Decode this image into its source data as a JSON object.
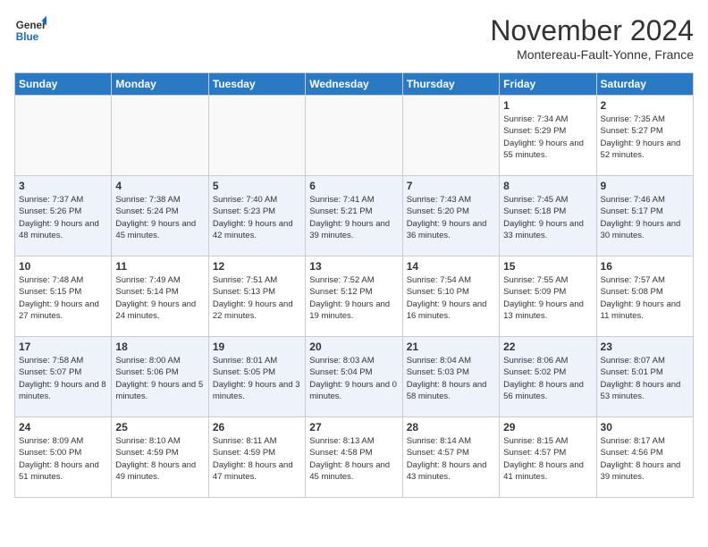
{
  "header": {
    "logo_general": "General",
    "logo_blue": "Blue",
    "month_title": "November 2024",
    "location": "Montereau-Fault-Yonne, France"
  },
  "weekdays": [
    "Sunday",
    "Monday",
    "Tuesday",
    "Wednesday",
    "Thursday",
    "Friday",
    "Saturday"
  ],
  "weeks": [
    [
      {
        "day": "",
        "empty": true
      },
      {
        "day": "",
        "empty": true
      },
      {
        "day": "",
        "empty": true
      },
      {
        "day": "",
        "empty": true
      },
      {
        "day": "",
        "empty": true
      },
      {
        "day": "1",
        "sunrise": "7:34 AM",
        "sunset": "5:29 PM",
        "daylight": "9 hours and 55 minutes."
      },
      {
        "day": "2",
        "sunrise": "7:35 AM",
        "sunset": "5:27 PM",
        "daylight": "9 hours and 52 minutes."
      }
    ],
    [
      {
        "day": "3",
        "sunrise": "7:37 AM",
        "sunset": "5:26 PM",
        "daylight": "9 hours and 48 minutes."
      },
      {
        "day": "4",
        "sunrise": "7:38 AM",
        "sunset": "5:24 PM",
        "daylight": "9 hours and 45 minutes."
      },
      {
        "day": "5",
        "sunrise": "7:40 AM",
        "sunset": "5:23 PM",
        "daylight": "9 hours and 42 minutes."
      },
      {
        "day": "6",
        "sunrise": "7:41 AM",
        "sunset": "5:21 PM",
        "daylight": "9 hours and 39 minutes."
      },
      {
        "day": "7",
        "sunrise": "7:43 AM",
        "sunset": "5:20 PM",
        "daylight": "9 hours and 36 minutes."
      },
      {
        "day": "8",
        "sunrise": "7:45 AM",
        "sunset": "5:18 PM",
        "daylight": "9 hours and 33 minutes."
      },
      {
        "day": "9",
        "sunrise": "7:46 AM",
        "sunset": "5:17 PM",
        "daylight": "9 hours and 30 minutes."
      }
    ],
    [
      {
        "day": "10",
        "sunrise": "7:48 AM",
        "sunset": "5:15 PM",
        "daylight": "9 hours and 27 minutes."
      },
      {
        "day": "11",
        "sunrise": "7:49 AM",
        "sunset": "5:14 PM",
        "daylight": "9 hours and 24 minutes."
      },
      {
        "day": "12",
        "sunrise": "7:51 AM",
        "sunset": "5:13 PM",
        "daylight": "9 hours and 22 minutes."
      },
      {
        "day": "13",
        "sunrise": "7:52 AM",
        "sunset": "5:12 PM",
        "daylight": "9 hours and 19 minutes."
      },
      {
        "day": "14",
        "sunrise": "7:54 AM",
        "sunset": "5:10 PM",
        "daylight": "9 hours and 16 minutes."
      },
      {
        "day": "15",
        "sunrise": "7:55 AM",
        "sunset": "5:09 PM",
        "daylight": "9 hours and 13 minutes."
      },
      {
        "day": "16",
        "sunrise": "7:57 AM",
        "sunset": "5:08 PM",
        "daylight": "9 hours and 11 minutes."
      }
    ],
    [
      {
        "day": "17",
        "sunrise": "7:58 AM",
        "sunset": "5:07 PM",
        "daylight": "9 hours and 8 minutes."
      },
      {
        "day": "18",
        "sunrise": "8:00 AM",
        "sunset": "5:06 PM",
        "daylight": "9 hours and 5 minutes."
      },
      {
        "day": "19",
        "sunrise": "8:01 AM",
        "sunset": "5:05 PM",
        "daylight": "9 hours and 3 minutes."
      },
      {
        "day": "20",
        "sunrise": "8:03 AM",
        "sunset": "5:04 PM",
        "daylight": "9 hours and 0 minutes."
      },
      {
        "day": "21",
        "sunrise": "8:04 AM",
        "sunset": "5:03 PM",
        "daylight": "8 hours and 58 minutes."
      },
      {
        "day": "22",
        "sunrise": "8:06 AM",
        "sunset": "5:02 PM",
        "daylight": "8 hours and 56 minutes."
      },
      {
        "day": "23",
        "sunrise": "8:07 AM",
        "sunset": "5:01 PM",
        "daylight": "8 hours and 53 minutes."
      }
    ],
    [
      {
        "day": "24",
        "sunrise": "8:09 AM",
        "sunset": "5:00 PM",
        "daylight": "8 hours and 51 minutes."
      },
      {
        "day": "25",
        "sunrise": "8:10 AM",
        "sunset": "4:59 PM",
        "daylight": "8 hours and 49 minutes."
      },
      {
        "day": "26",
        "sunrise": "8:11 AM",
        "sunset": "4:59 PM",
        "daylight": "8 hours and 47 minutes."
      },
      {
        "day": "27",
        "sunrise": "8:13 AM",
        "sunset": "4:58 PM",
        "daylight": "8 hours and 45 minutes."
      },
      {
        "day": "28",
        "sunrise": "8:14 AM",
        "sunset": "4:57 PM",
        "daylight": "8 hours and 43 minutes."
      },
      {
        "day": "29",
        "sunrise": "8:15 AM",
        "sunset": "4:57 PM",
        "daylight": "8 hours and 41 minutes."
      },
      {
        "day": "30",
        "sunrise": "8:17 AM",
        "sunset": "4:56 PM",
        "daylight": "8 hours and 39 minutes."
      }
    ]
  ]
}
